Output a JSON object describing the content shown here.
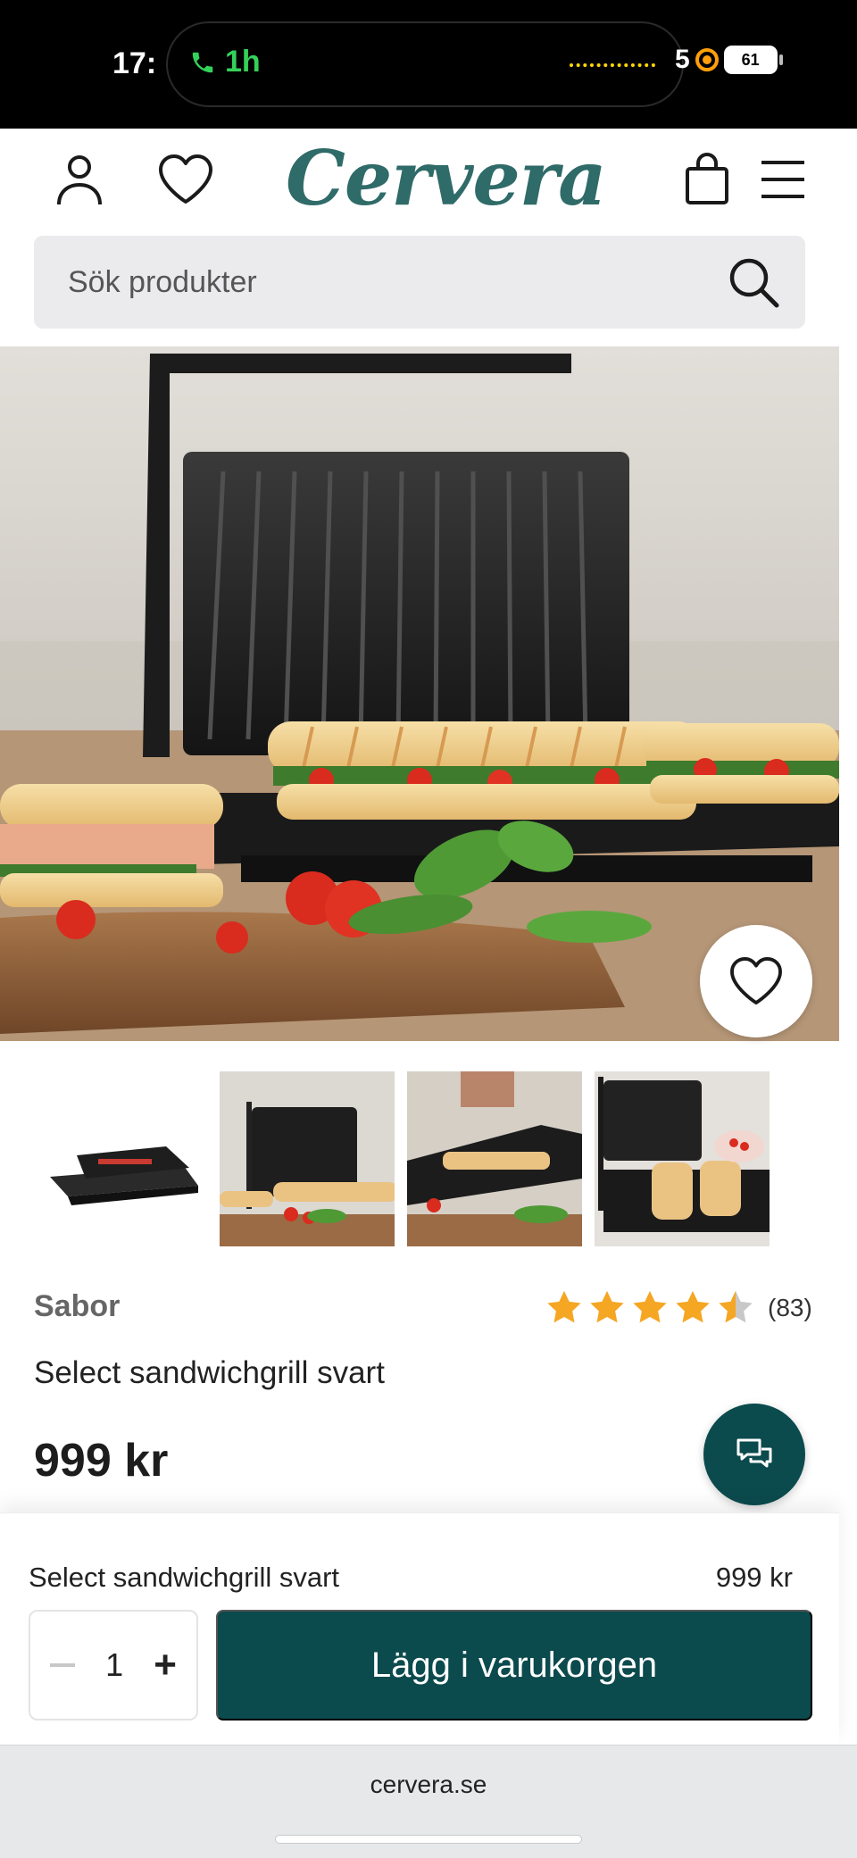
{
  "status_bar": {
    "time": "17:",
    "call_duration": "1h",
    "partial_digit": "5",
    "battery": "61"
  },
  "header": {
    "logo": "Cervera",
    "icons": [
      "account-icon",
      "wishlist-icon",
      "cart-icon",
      "menu-icon"
    ]
  },
  "search": {
    "placeholder": "Sök produkter"
  },
  "product": {
    "brand": "Sabor",
    "rating": 4.5,
    "rating_count": "(83)",
    "name": "Select sandwichgrill svart",
    "price": "999 kr"
  },
  "sticky_bar": {
    "name": "Select sandwichgrill svart",
    "price": "999 kr",
    "quantity": "1",
    "add_to_cart_label": "Lägg i varukorgen"
  },
  "browser": {
    "url": "cervera.se"
  },
  "colors": {
    "brand_teal": "#2f6b68",
    "button_dark": "#0b4a4d",
    "star": "#f5a623"
  }
}
